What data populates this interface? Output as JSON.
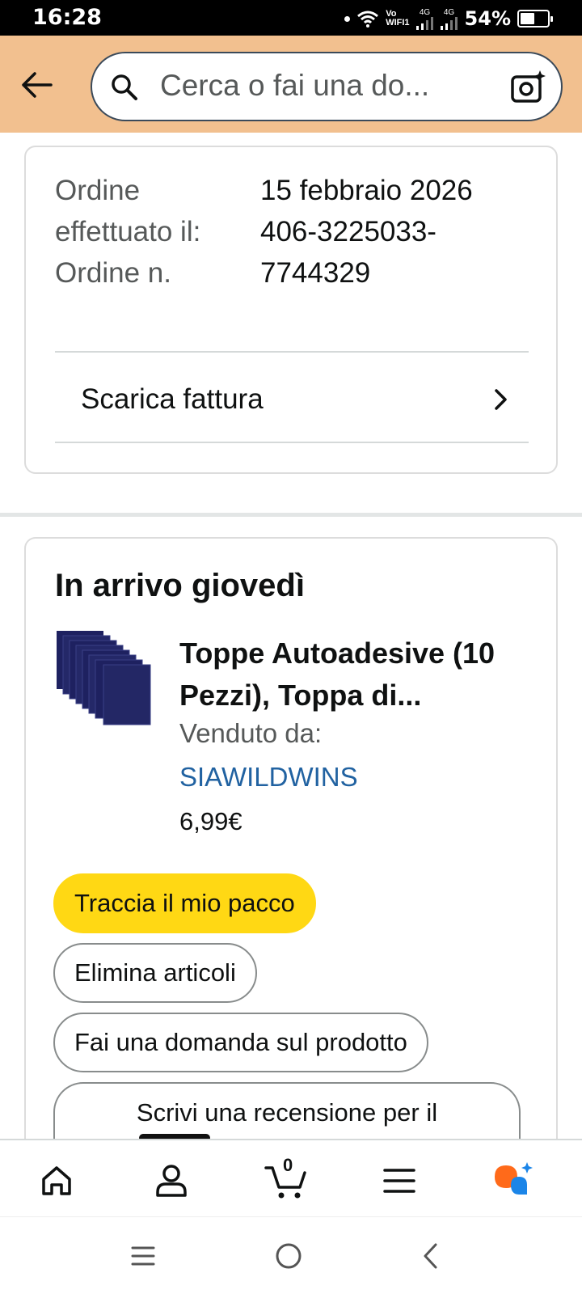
{
  "status_bar": {
    "time": "16:28",
    "vo": "Vo",
    "wifi_label": "WIFI1",
    "network_1": "4G",
    "network_2": "4G",
    "battery_text": "54%",
    "battery_level": 0.54
  },
  "header": {
    "search_placeholder": "Cerca o fai una do...",
    "accent_color": "#f2c08f"
  },
  "order": {
    "placed_label": "Ordine effettuato il:",
    "number_label": "Ordine n.",
    "placed_date": "15 febbraio 2026",
    "order_number": "406-3225033-7744329",
    "invoice_label": "Scarica fattura"
  },
  "delivery": {
    "title": "In arrivo giovedì",
    "product_title": "Toppe Autoadesive (10 Pezzi), Toppa di...",
    "sold_by_label": "Venduto da:",
    "seller": "SIAWILDWINS",
    "price": "6,99€",
    "buttons": {
      "track": "Traccia il mio pacco",
      "delete": "Elimina articoli",
      "ask": "Fai una domanda sul prodotto",
      "review": "Scrivi una recensione per il"
    }
  },
  "bottom_nav": {
    "items": [
      "home-icon",
      "account-icon",
      "cart-icon",
      "menu-icon",
      "rufus-icon"
    ],
    "cart_count": "0"
  },
  "system_nav": [
    "recents-icon",
    "home-circle-icon",
    "back-triangle-icon"
  ]
}
